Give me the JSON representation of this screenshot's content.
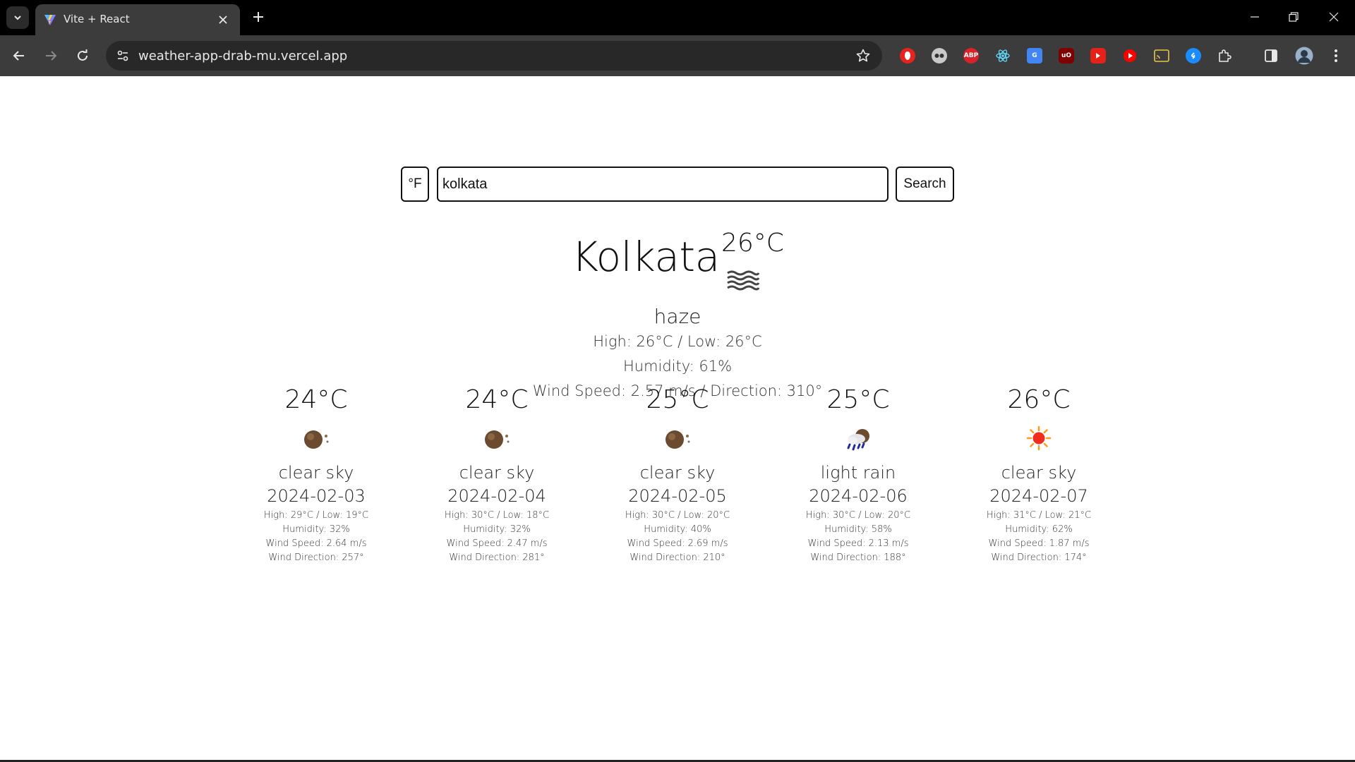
{
  "browser": {
    "tab_title": "Vite + React",
    "url": "weather-app-drab-mu.vercel.app",
    "extensions": [
      {
        "name": "shield-extension-icon",
        "color": "#e8231f",
        "label": ""
      },
      {
        "name": "avatar-extension-icon",
        "color": "#c9c9c9",
        "label": ""
      },
      {
        "name": "adblock-plus-icon",
        "color": "#d8232a",
        "label": "ABP"
      },
      {
        "name": "react-devtools-icon",
        "color": "#3c3c3c",
        "label": ""
      },
      {
        "name": "google-translate-icon",
        "color": "#4285f4",
        "label": "G"
      },
      {
        "name": "ublock-origin-icon",
        "color": "#800000",
        "label": "uO"
      },
      {
        "name": "youtube-extension-icon",
        "color": "#e62117",
        "label": ""
      },
      {
        "name": "youtube-icon",
        "color": "#ff0000",
        "label": ""
      },
      {
        "name": "cast-icon",
        "color": "#e8c547",
        "label": ""
      },
      {
        "name": "shazam-icon",
        "color": "#1a8cff",
        "label": ""
      }
    ]
  },
  "search": {
    "unit_toggle_label": "°F",
    "input_value": "kolkata",
    "button_label": "Search"
  },
  "current": {
    "city": "Kolkata",
    "temp": "26°C",
    "icon": "haze-icon",
    "description": "haze",
    "high_low": "High: 26°C / Low: 26°C",
    "humidity": "Humidity: 61%",
    "wind": "Wind Speed: 2.57 m/s / Direction: 310°"
  },
  "forecast": [
    {
      "temp": "24°C",
      "icon": "clear-night-icon",
      "description": "clear sky",
      "date": "2024-02-03",
      "high_low": "High: 29°C / Low: 19°C",
      "humidity": "Humidity: 32%",
      "wind_speed": "Wind Speed: 2.64 m/s",
      "wind_direction": "Wind Direction: 257°"
    },
    {
      "temp": "24°C",
      "icon": "clear-night-icon",
      "description": "clear sky",
      "date": "2024-02-04",
      "high_low": "High: 30°C / Low: 18°C",
      "humidity": "Humidity: 32%",
      "wind_speed": "Wind Speed: 2.47 m/s",
      "wind_direction": "Wind Direction: 281°"
    },
    {
      "temp": "25°C",
      "icon": "clear-night-icon",
      "description": "clear sky",
      "date": "2024-02-05",
      "high_low": "High: 30°C / Low: 20°C",
      "humidity": "Humidity: 40%",
      "wind_speed": "Wind Speed: 2.69 m/s",
      "wind_direction": "Wind Direction: 210°"
    },
    {
      "temp": "25°C",
      "icon": "rain-night-icon",
      "description": "light rain",
      "date": "2024-02-06",
      "high_low": "High: 30°C / Low: 20°C",
      "humidity": "Humidity: 58%",
      "wind_speed": "Wind Speed: 2.13 m/s",
      "wind_direction": "Wind Direction: 188°"
    },
    {
      "temp": "26°C",
      "icon": "sun-icon",
      "description": "clear sky",
      "date": "2024-02-07",
      "high_low": "High: 31°C / Low: 21°C",
      "humidity": "Humidity: 62%",
      "wind_speed": "Wind Speed: 1.87 m/s",
      "wind_direction": "Wind Direction: 174°"
    }
  ]
}
